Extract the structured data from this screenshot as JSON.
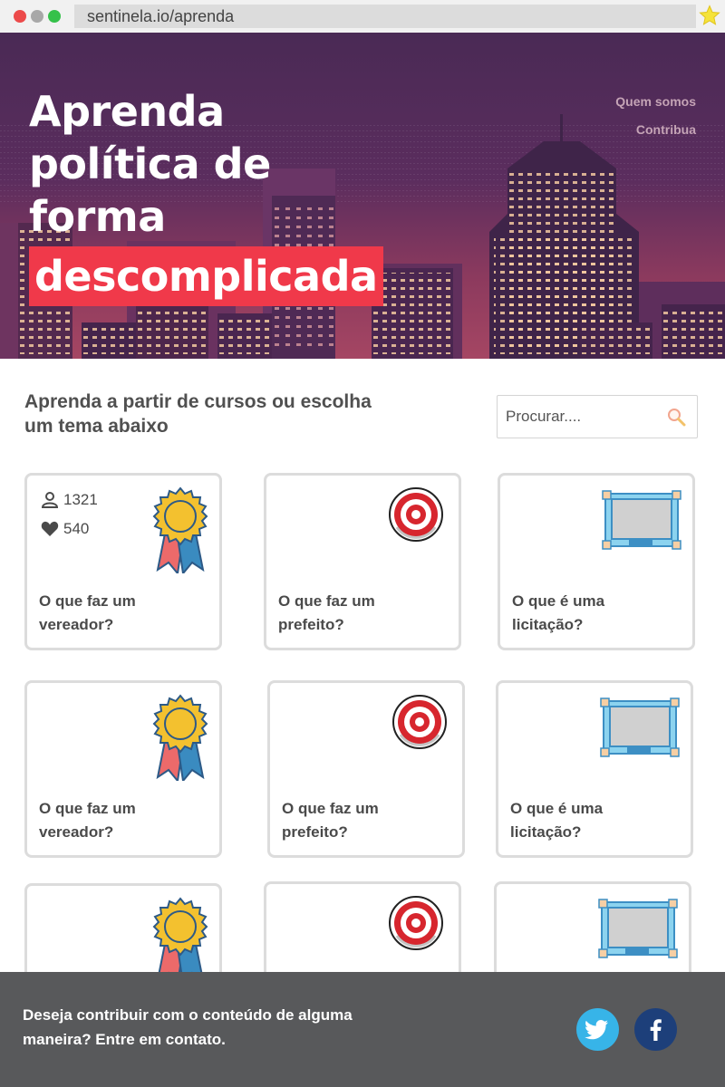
{
  "browser": {
    "url": "sentinela.io/aprenda"
  },
  "hero": {
    "title_lines": [
      "Aprenda",
      "política de",
      "forma"
    ],
    "title_highlight": "descomplicada",
    "nav": [
      "Quem somos",
      "Contribua"
    ]
  },
  "intro": {
    "text": "Aprenda a partir de cursos ou escolha um tema abaixo"
  },
  "search": {
    "placeholder": "Procurar...."
  },
  "cards": [
    {
      "title_line1": "O que faz um",
      "title_line2": "vereador?",
      "icon": "ribbon-award-icon",
      "users": "1321",
      "likes": "540"
    },
    {
      "title_line1": "O que faz um",
      "title_line2": "prefeito?",
      "icon": "target-icon"
    },
    {
      "title_line1": "O que é uma",
      "title_line2": "licitação?",
      "icon": "whiteboard-icon"
    },
    {
      "title_line1": "O que faz um",
      "title_line2": "vereador?",
      "icon": "ribbon-award-icon"
    },
    {
      "title_line1": "O que faz um",
      "title_line2": "prefeito?",
      "icon": "target-icon"
    },
    {
      "title_line1": "O que é uma",
      "title_line2": "licitação?",
      "icon": "whiteboard-icon"
    },
    {
      "icon": "ribbon-award-icon"
    },
    {
      "icon": "target-icon"
    },
    {
      "icon": "whiteboard-icon"
    }
  ],
  "footer": {
    "text_line1": "Deseja contribuir com o conteúdo de alguma",
    "text_line2": "maneira? Entre em contato.",
    "social": [
      "twitter-icon",
      "facebook-icon"
    ]
  },
  "colors": {
    "highlight": "#f0394a",
    "footer_bg": "#58595b",
    "twitter": "#37b4e8",
    "facebook": "#1d3f7a"
  }
}
